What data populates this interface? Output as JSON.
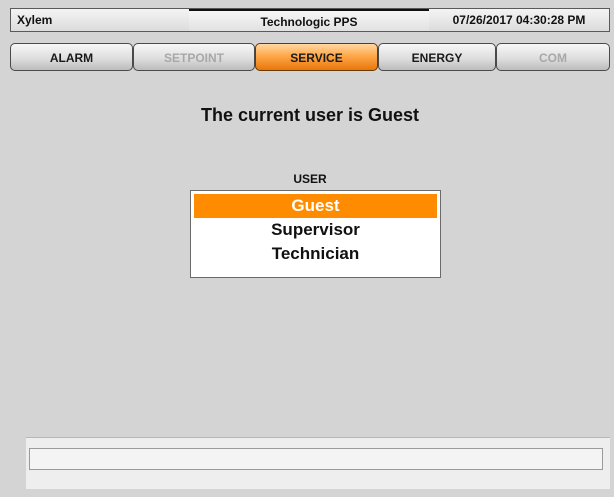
{
  "titlebar": {
    "app_name": "Xylem",
    "product": "Technologic PPS",
    "datetime": "07/26/2017 04:30:28 PM"
  },
  "nav": {
    "tabs": [
      {
        "label": "ALARM",
        "state": "enabled"
      },
      {
        "label": "SETPOINT",
        "state": "disabled"
      },
      {
        "label": "SERVICE",
        "state": "active"
      },
      {
        "label": "ENERGY",
        "state": "enabled"
      },
      {
        "label": "COM",
        "state": "disabled"
      }
    ]
  },
  "main": {
    "current_user_text": "The current user is Guest",
    "user_label": "USER",
    "users": [
      {
        "label": "Guest",
        "selected": true
      },
      {
        "label": "Supervisor",
        "selected": false
      },
      {
        "label": "Technician",
        "selected": false
      }
    ]
  },
  "status": {
    "message": ""
  },
  "colors": {
    "background": "#d4d4d4",
    "accent": "#ff8c00",
    "disabled_text": "#a8a8a8"
  }
}
